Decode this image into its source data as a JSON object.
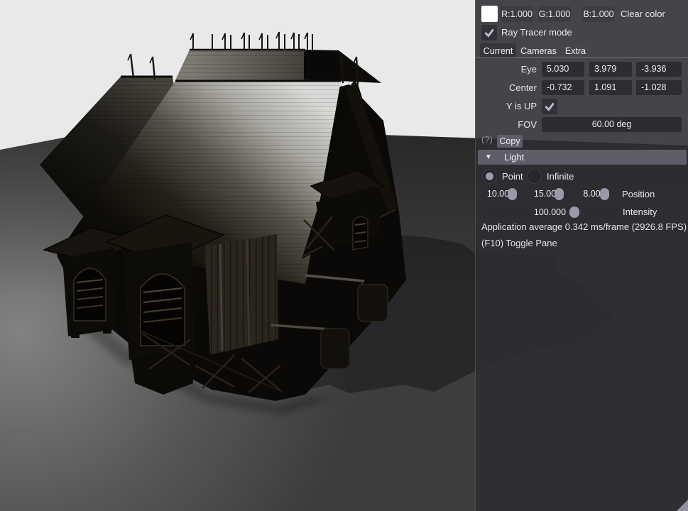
{
  "scene": {
    "colors": {
      "background": "#e9e9e9",
      "ground_near": "#828282",
      "ground_mid": "#575757",
      "ground_far": "#3d3d3d",
      "shadow": "#0a0a0c",
      "roof_sheen": "#d8d8d6",
      "house_dark": "#0a0908"
    }
  },
  "panel": {
    "colors": {
      "header_bg": "#5e5e68",
      "accent": "#9a9aaa",
      "swatch": "#ffffff"
    },
    "clear_color": {
      "r_label": "R:1.000",
      "g_label": "G:1.000",
      "b_label": "B:1.000",
      "label": "Clear color",
      "swatch_color": "#ffffff"
    },
    "ray_tracer": {
      "label": "Ray Tracer mode",
      "checked": true
    },
    "tabs": [
      {
        "label": "Current",
        "active": true
      },
      {
        "label": "Cameras",
        "active": false
      },
      {
        "label": "Extra",
        "active": false
      }
    ],
    "camera": {
      "eye": {
        "label": "Eye",
        "values": [
          "5.030",
          "3.979",
          "-3.936"
        ]
      },
      "center": {
        "label": "Center",
        "values": [
          "-0.732",
          "1.091",
          "-1.028"
        ]
      },
      "y_is_up": {
        "label": "Y is UP",
        "checked": true
      },
      "fov": {
        "label": "FOV",
        "value": "60.00 deg"
      },
      "help_label": "(?)",
      "copy_label": "Copy"
    },
    "light": {
      "header": "Light",
      "type_options": [
        {
          "label": "Point",
          "selected": true
        },
        {
          "label": "Infinite",
          "selected": false
        }
      ],
      "position": {
        "values": [
          "10.000",
          "15.000",
          "8.000"
        ],
        "label": "Position"
      },
      "intensity": {
        "value": "100.000",
        "label": "Intensity"
      }
    },
    "stats": "Application average 0.342 ms/frame (2926.8 FPS)",
    "toggle_hint": "(F10) Toggle Pane"
  }
}
